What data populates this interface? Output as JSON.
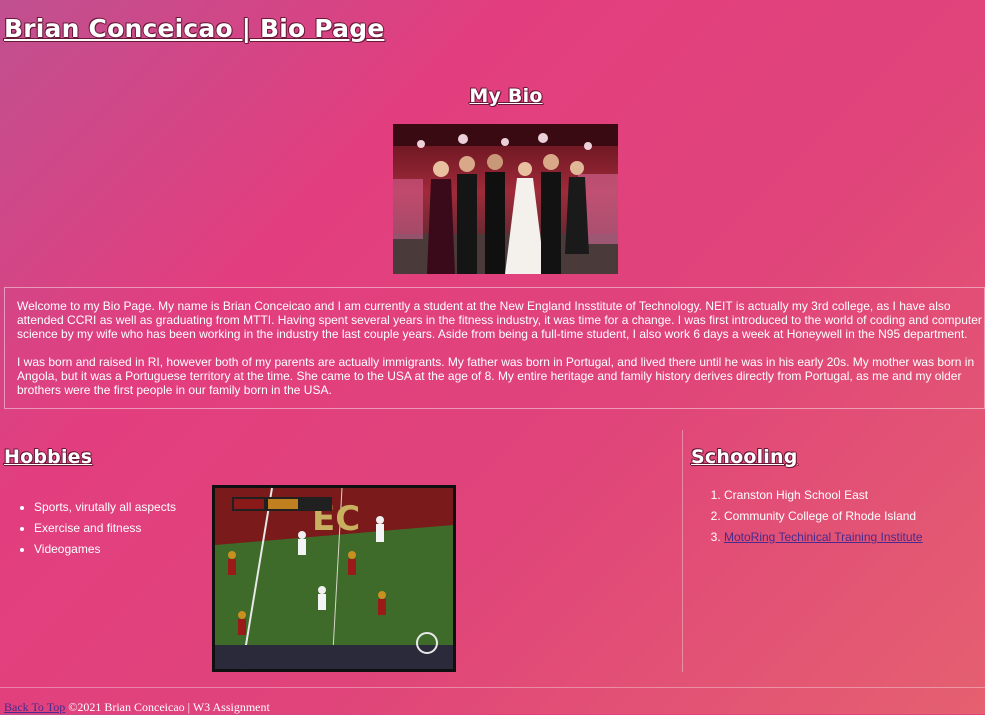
{
  "header": {
    "title": "Brian Conceicao | Bio Page"
  },
  "bio": {
    "heading": "My Bio",
    "photo_icon": "group-wedding-photo",
    "paragraphs": [
      "Welcome to my Bio Page. My name is Brian Conceicao and I am currently a student at the New England Insstitute of Technology. NEIT is actually my 3rd college, as I have also attended CCRI as well as graduating from MTTI. Having spent several years in the fitness industry, it was time for a change. I was first introduced to the world of coding and computer science by my wife who has been working in the industry the last couple years. Aside from being a full-time student, I also work 6 days a week at Honeywell in the N95 department.",
      "I was born and raised in RI, however both of my parents are actually immigrants. My father was born in Portugal, and lived there until he was in his early 20s. My mother was born in Angola, but it was a Portuguese territory at the time. She came to the USA at the age of 8. My entire heritage and family history derives directly from Portugal, as me and my older brothers were the first people in our family born in the USA."
    ]
  },
  "hobbies": {
    "heading": "Hobbies",
    "items": [
      "Sports, virutally all aspects",
      "Exercise and fitness",
      "Videogames"
    ],
    "photo_icon": "football-game-photo"
  },
  "schooling": {
    "heading": "Schooling",
    "items": [
      {
        "label": "Cranston High School East",
        "link": false
      },
      {
        "label": "Community College of Rhode Island",
        "link": false
      },
      {
        "label": "MotoRing Techinical Training Institute",
        "link": true
      }
    ]
  },
  "footer": {
    "back_to_top": "Back To Top",
    "copyright": "©2021 Brian Conceicao | W3 Assignment"
  }
}
